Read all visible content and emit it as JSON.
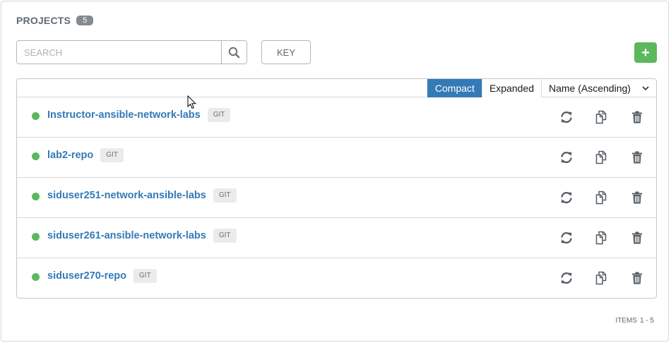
{
  "header": {
    "title": "PROJECTS",
    "count": "5"
  },
  "search": {
    "placeholder": "SEARCH",
    "value": ""
  },
  "key_button": {
    "label": "KEY"
  },
  "add_button": {
    "label": "+"
  },
  "view": {
    "compact_label": "Compact",
    "expanded_label": "Expanded",
    "active": "Compact",
    "sort_label": "Name (Ascending)"
  },
  "projects": [
    {
      "name": "Instructor-ansible-network-labs",
      "scm": "GIT",
      "status": "success"
    },
    {
      "name": "lab2-repo",
      "scm": "GIT",
      "status": "success"
    },
    {
      "name": "siduser251-network-ansible-labs",
      "scm": "GIT",
      "status": "success"
    },
    {
      "name": "siduser261-ansible-network-labs",
      "scm": "GIT",
      "status": "success"
    },
    {
      "name": "siduser270-repo",
      "scm": "GIT",
      "status": "success"
    }
  ],
  "icons": {
    "search": "search-icon",
    "sync": "sync-icon",
    "copy": "copy-icon",
    "delete": "trash-icon",
    "sort_toggle": "chevron-down-icon"
  },
  "colors": {
    "accent": "#337ab7",
    "success": "#5cb85c",
    "badge": "#848992"
  },
  "footer": {
    "label": "ITEMS",
    "range": "1 - 5"
  }
}
